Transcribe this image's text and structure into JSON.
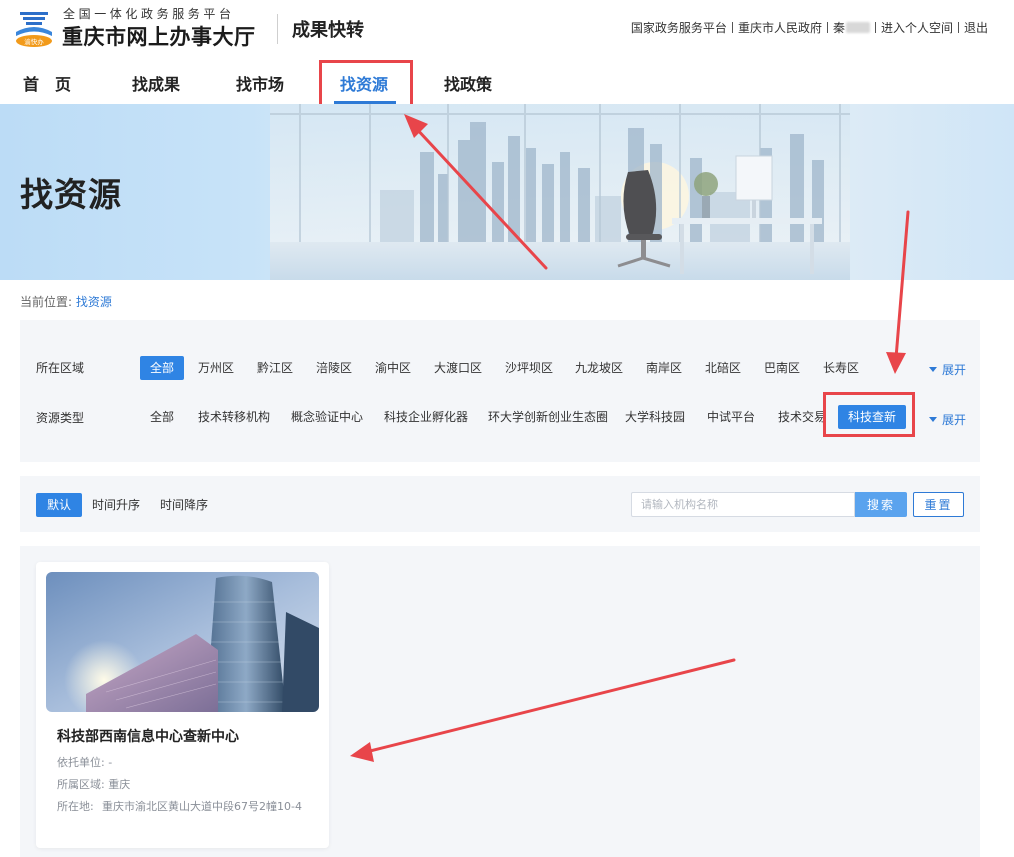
{
  "header": {
    "brand_sub": "全国一体化政务服务平台",
    "brand_main": "重庆市网上办事大厅",
    "app_name": "成果快转",
    "logo_badge": "渝快办",
    "links": {
      "national": "国家政务服务平台",
      "city_gov": "重庆市人民政府",
      "user": "秦",
      "space": "进入个人空间",
      "logout": "退出"
    }
  },
  "nav": {
    "home": "首　页",
    "results": "找成果",
    "market": "找市场",
    "resources": "找资源",
    "policy": "找政策"
  },
  "banner": {
    "title": "找资源"
  },
  "breadcrumb": {
    "prefix": "当前位置:",
    "current": "找资源"
  },
  "filters": {
    "region_label": "所在区域",
    "regions": [
      "全部",
      "万州区",
      "黔江区",
      "涪陵区",
      "渝中区",
      "大渡口区",
      "沙坪坝区",
      "九龙坡区",
      "南岸区",
      "北碚区",
      "巴南区",
      "长寿区"
    ],
    "selected_region": "全部",
    "type_label": "资源类型",
    "types": [
      "全部",
      "技术转移机构",
      "概念验证中心",
      "科技企业孵化器",
      "环大学创新创业生态圈",
      "大学科技园",
      "中试平台",
      "技术交易",
      "科技查新"
    ],
    "selected_type": "科技查新",
    "expand_label": "展开"
  },
  "sort": {
    "options": [
      "默认",
      "时间升序",
      "时间降序"
    ],
    "selected": "默认"
  },
  "search": {
    "placeholder": "请输入机构名称",
    "value": "",
    "search_label": "搜索",
    "reset_label": "重置"
  },
  "results": [
    {
      "title": "科技部西南信息中心查新中心",
      "support_unit_label": "依托单位:",
      "support_unit": "-",
      "region_label": "所属区域:",
      "region": "重庆",
      "address_label": "所在地:",
      "address": "重庆市渝北区黄山大道中段67号2幢10-4"
    }
  ],
  "colors": {
    "accent": "#2e7ad6",
    "chip_selected": "#2f84e4",
    "highlight": "#e8454a",
    "panel_bg": "#f4f6f9"
  },
  "icons": {
    "logo": "emblem-logo",
    "expand": "triangle-down-icon"
  }
}
